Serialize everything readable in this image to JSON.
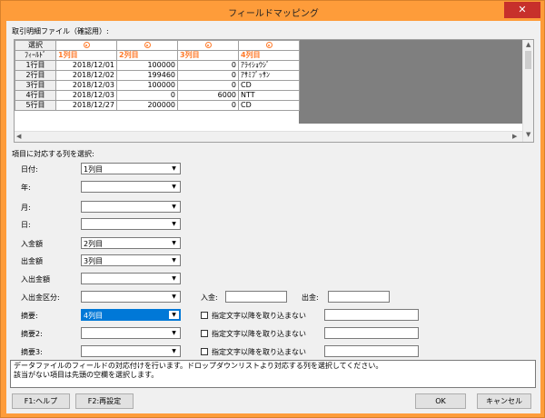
{
  "window": {
    "title": "フィールドマッピング",
    "close_label": "✕"
  },
  "grid": {
    "label": "取引明細ファイル（確認用）:",
    "select_header": "選択",
    "field_header": "ﾌｨｰﾙﾄﾞ",
    "columns": [
      "1列目",
      "2列目",
      "3列目",
      "4列目"
    ],
    "rows": [
      {
        "name": "1行目",
        "cells": [
          "2018/12/01",
          "100000",
          "0",
          "ｱﾗｲｼｮｳｼﾞ"
        ]
      },
      {
        "name": "2行目",
        "cells": [
          "2018/12/02",
          "199460",
          "0",
          "ｱｻﾐﾌﾞｯｻﾝ"
        ]
      },
      {
        "name": "3行目",
        "cells": [
          "2018/12/03",
          "100000",
          "0",
          "CD"
        ]
      },
      {
        "name": "4行目",
        "cells": [
          "2018/12/03",
          "0",
          "6000",
          "NTT"
        ]
      },
      {
        "name": "5行目",
        "cells": [
          "2018/12/27",
          "200000",
          "0",
          "CD"
        ]
      }
    ]
  },
  "mapping": {
    "label": "項目に対応する列を選択:",
    "fields": [
      {
        "label": "日付:",
        "value": "1列目"
      },
      {
        "label": "年:",
        "value": ""
      },
      {
        "label": "月:",
        "value": ""
      },
      {
        "label": "日:",
        "value": ""
      },
      {
        "label": "入金額",
        "value": "2列目"
      },
      {
        "label": "出金額",
        "value": "3列目"
      },
      {
        "label": "入出金額",
        "value": ""
      },
      {
        "label": "入出金区分:",
        "value": ""
      },
      {
        "label": "摘要:",
        "value": "4列目"
      },
      {
        "label": "摘要2:",
        "value": ""
      },
      {
        "label": "摘要3:",
        "value": ""
      }
    ],
    "deposit_label": "入金:",
    "withdraw_label": "出金:",
    "checkbox_label": "指定文字以降を取り込まない"
  },
  "description": [
    "データファイルのフィールドの対応付けを行います。ドロップダウンリストより対応する列を選択してください。",
    "該当がない項目は先頭の空欄を選択します。"
  ],
  "buttons": {
    "help": "F1:ヘルプ",
    "reset": "F2:再設定",
    "ok": "OK",
    "cancel": "キャンセル"
  },
  "colors": {
    "title_bar": "#fe9c3a",
    "close": "#c7302b",
    "header_text": "#ff7a2a",
    "selected": "#0078d7",
    "grid_empty": "#7f7f7f"
  }
}
